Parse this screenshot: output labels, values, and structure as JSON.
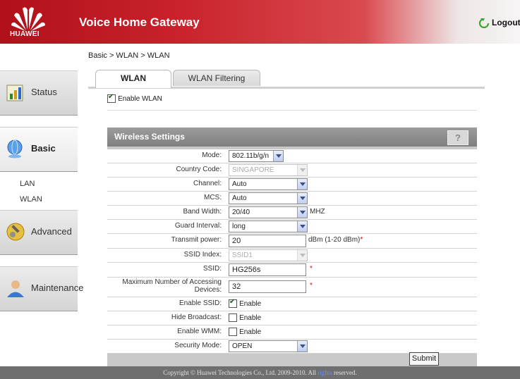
{
  "header": {
    "brand": "HUAWEI",
    "title": "Voice Home Gateway",
    "logout": "Logout"
  },
  "sidebar": {
    "items": [
      {
        "label": "Status",
        "icon": "chart-icon"
      },
      {
        "label": "Basic",
        "icon": "globe-icon"
      },
      {
        "label": "Advanced",
        "icon": "tools-icon"
      },
      {
        "label": "Maintenance",
        "icon": "user-icon"
      }
    ],
    "sub_items": [
      "LAN",
      "WLAN"
    ]
  },
  "breadcrumb": "Basic > WLAN > WLAN",
  "tabs": [
    "WLAN",
    "WLAN Filtering"
  ],
  "enable_wlan": {
    "label": "Enable WLAN",
    "checked": true
  },
  "panel": {
    "title": "Wireless Settings",
    "help": "?",
    "mode": {
      "label": "Mode:",
      "value": "802.11b/g/n"
    },
    "country": {
      "label": "Country Code:",
      "value": "SINGAPORE"
    },
    "channel": {
      "label": "Channel:",
      "value": "Auto"
    },
    "mcs": {
      "label": "MCS:",
      "value": "Auto"
    },
    "bandwidth": {
      "label": "Band Width:",
      "value": "20/40",
      "unit": "MHZ"
    },
    "guard": {
      "label": "Guard Interval:",
      "value": "long"
    },
    "txpower": {
      "label": "Transmit power:",
      "value": "20",
      "unit": "dBm (1-20 dBm)",
      "req": "*"
    },
    "ssid_index": {
      "label": "SSID Index:",
      "value": "SSID1"
    },
    "ssid": {
      "label": "SSID:",
      "value": "HG256s",
      "req": "*"
    },
    "max_devices": {
      "label": "Maximum Number of Accessing Devices:",
      "value": "32",
      "req": "*"
    },
    "enable_ssid": {
      "label": "Enable SSID:",
      "option": "Enable",
      "checked": true
    },
    "hide_broadcast": {
      "label": "Hide Broadcast:",
      "option": "Enable",
      "checked": false
    },
    "enable_wmm": {
      "label": "Enable WMM:",
      "option": "Enable",
      "checked": false
    },
    "security": {
      "label": "Security Mode:",
      "value": "OPEN"
    }
  },
  "submit": "Submit",
  "footer": {
    "text_before": "Copyright © Huawei Technologies Co., Ltd. 2009-2010. All",
    "link": "rights",
    "text_after": "reserved."
  }
}
